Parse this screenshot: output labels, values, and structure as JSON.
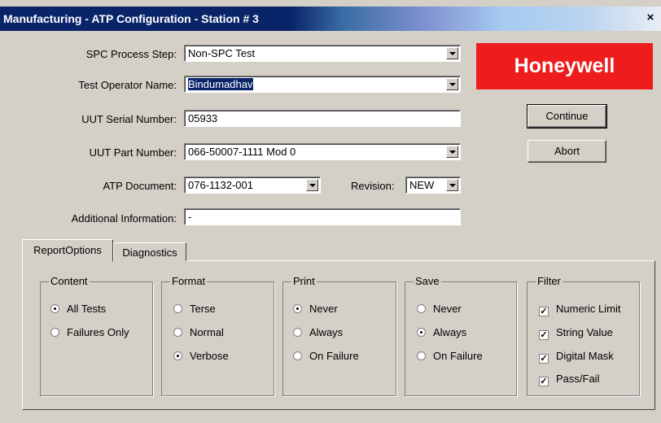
{
  "window": {
    "title": "Manufacturing - ATP Configuration - Station # 3",
    "close_symbol": "×"
  },
  "form": {
    "spc_label": "SPC Process Step:",
    "spc_value": "Non-SPC Test",
    "operator_label": "Test Operator Name:",
    "operator_value": "Bindumadhav",
    "serial_label": "UUT Serial Number:",
    "serial_value": "05933",
    "part_label": "UUT Part Number:",
    "part_value": "066-50007-1111 Mod 0",
    "atp_label": "ATP Document:",
    "atp_value": "076-1132-001",
    "revision_label": "Revision:",
    "revision_value": "NEW",
    "info_label": "Additional Information:",
    "info_value": "-"
  },
  "logo": {
    "text": "Honeywell",
    "color": "#ee1c1c"
  },
  "buttons": {
    "continue": "Continue",
    "abort": "Abort"
  },
  "tabs": [
    "ReportOptions",
    "Diagnostics"
  ],
  "groups": {
    "content": {
      "title": "Content",
      "options": [
        "All Tests",
        "Failures Only"
      ],
      "selected": "All Tests"
    },
    "format": {
      "title": "Format",
      "options": [
        "Terse",
        "Normal",
        "Verbose"
      ],
      "selected": "Verbose"
    },
    "print": {
      "title": "Print",
      "options": [
        "Never",
        "Always",
        "On Failure"
      ],
      "selected": "Never"
    },
    "save": {
      "title": "Save",
      "options": [
        "Never",
        "Always",
        "On Failure"
      ],
      "selected": "Always"
    },
    "filter": {
      "title": "Filter",
      "options": [
        "Numeric Limit",
        "String Value",
        "Digital Mask",
        "Pass/Fail"
      ],
      "checked": [
        true,
        true,
        true,
        true
      ]
    }
  }
}
